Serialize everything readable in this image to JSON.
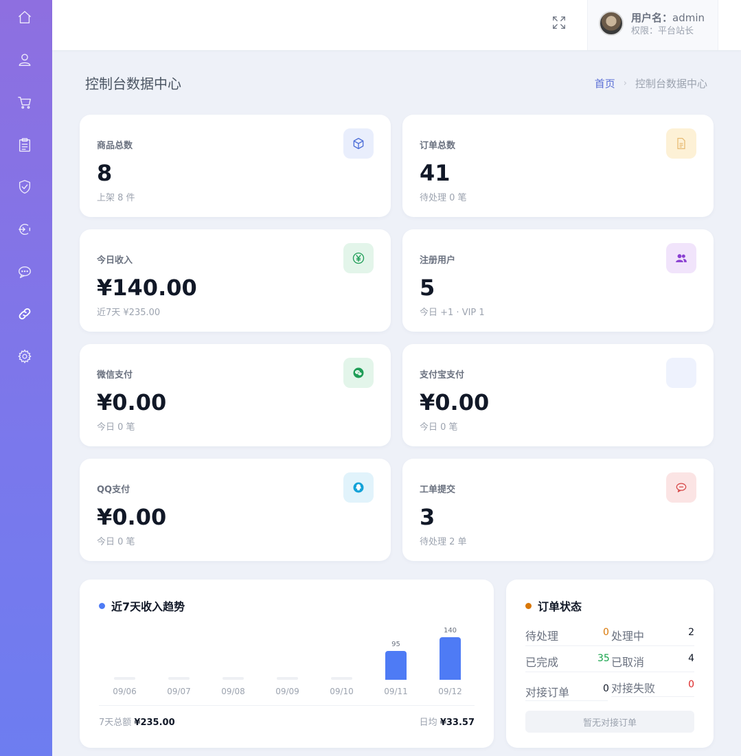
{
  "header": {
    "user_label": "用户名：",
    "user_name": "admin",
    "role_text": "权限：平台站长"
  },
  "page": {
    "title": "控制台数据中心",
    "breadcrumb_home": "首页",
    "breadcrumb_sep": "›",
    "breadcrumb_current": "控制台数据中心"
  },
  "sidebar": {
    "items": [
      {
        "icon": "home-icon"
      },
      {
        "icon": "user-icon"
      },
      {
        "icon": "cart-icon"
      },
      {
        "icon": "clipboard-icon"
      },
      {
        "icon": "shield-check-icon"
      },
      {
        "icon": "plugin-icon"
      },
      {
        "icon": "chat-icon"
      },
      {
        "icon": "link-icon",
        "active": true
      },
      {
        "icon": "gear-icon"
      }
    ]
  },
  "stats": {
    "goods": {
      "label": "商品总数",
      "value": "8",
      "sub": "上架 8 件",
      "icon": "cube-icon"
    },
    "orders": {
      "label": "订单总数",
      "value": "41",
      "sub": "待处理 0 笔",
      "icon": "document-icon"
    },
    "income": {
      "label": "今日收入",
      "value": "¥140.00",
      "sub": "近7天 ¥235.00",
      "icon": "yuan-icon"
    },
    "users": {
      "label": "注册用户",
      "value": "5",
      "sub": "今日 +1 · VIP 1",
      "icon": "users-icon"
    },
    "wechat": {
      "label": "微信支付",
      "value": "¥0.00",
      "sub": "今日 0 笔",
      "icon": "wechat-icon"
    },
    "alipay": {
      "label": "支付宝支付",
      "value": "¥0.00",
      "sub": "今日 0 笔",
      "icon": "alipay-icon"
    },
    "qq": {
      "label": "QQ支付",
      "value": "¥0.00",
      "sub": "今日 0 笔",
      "icon": "qq-icon"
    },
    "tickets": {
      "label": "工单提交",
      "value": "3",
      "sub": "待处理 2 单",
      "icon": "ticket-chat-icon"
    }
  },
  "colors": {
    "accent": "#4e7bf5",
    "orange": "#d97706",
    "green": "#16a34a",
    "red": "#dc2626"
  },
  "revenue": {
    "title": "近7天收入趋势",
    "total_label": "7天总额",
    "total_value": "¥235.00",
    "avg_label": "日均",
    "avg_value": "¥33.57"
  },
  "chart_data": {
    "type": "bar",
    "categories": [
      "09/06",
      "09/07",
      "09/08",
      "09/09",
      "09/10",
      "09/11",
      "09/12"
    ],
    "values": [
      0,
      0,
      0,
      0,
      0,
      95,
      140
    ],
    "value_labels": [
      "",
      "",
      "",
      "",
      "",
      "95",
      "140"
    ],
    "title": "近7天收入趋势",
    "xlabel": "",
    "ylabel": "",
    "grid": false
  },
  "order_status": {
    "title": "订单状态",
    "pending_label": "待处理",
    "pending_value": "0",
    "processing_label": "处理中",
    "processing_value": "2",
    "done_label": "已完成",
    "done_value": "35",
    "cancel_label": "已取消",
    "cancel_value": "4",
    "dock_label": "对接订单",
    "dock_value": "0",
    "dock_fail_label": "对接失败",
    "dock_fail_value": "0",
    "empty_button": "暂无对接订单"
  }
}
